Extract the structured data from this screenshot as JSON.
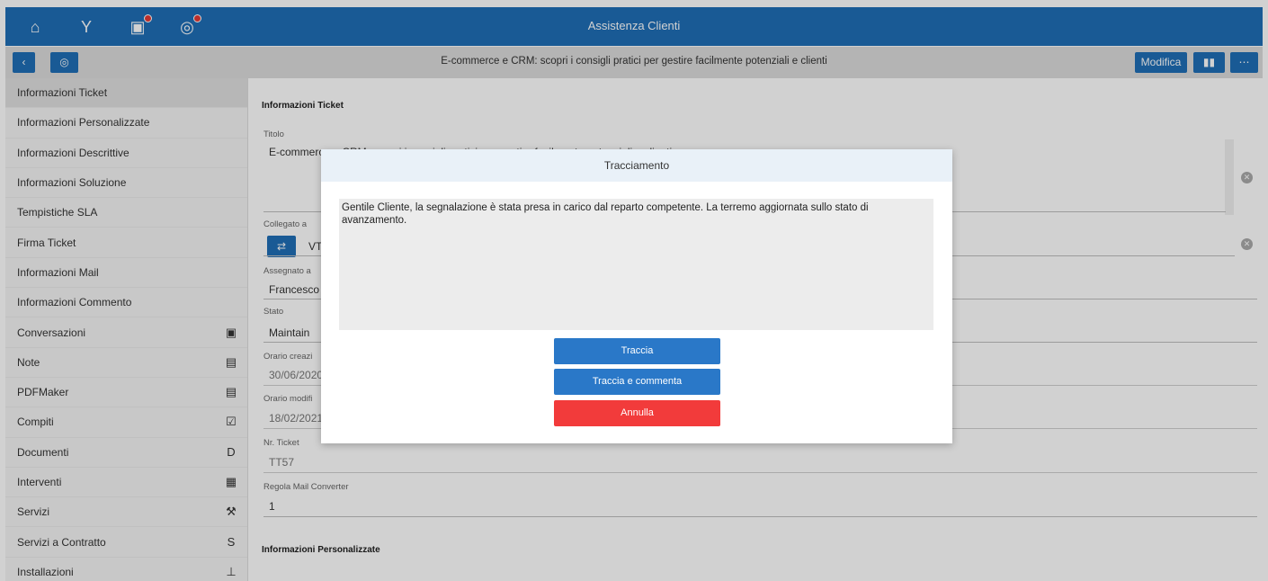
{
  "app": {
    "title": "Assistenza Clienti"
  },
  "topbar": {
    "icons": [
      {
        "name": "home-icon",
        "glyph": "⌂"
      },
      {
        "name": "filter-icon",
        "glyph": "Y"
      },
      {
        "name": "chat-icon",
        "glyph": "▣",
        "badge": true
      },
      {
        "name": "globe-icon",
        "glyph": "◎",
        "badge": true
      }
    ]
  },
  "subbar": {
    "back_glyph": "‹",
    "globe_glyph": "◎",
    "record_title": "E-commerce e CRM: scopri i consigli pratici per gestire facilmente potenziali e clienti",
    "edit_label": "Modifica",
    "stats_glyph": "▮▮",
    "more_glyph": "⋯"
  },
  "sidebar": {
    "items": [
      {
        "label": "Informazioni Ticket",
        "icon": "",
        "active": true
      },
      {
        "label": "Informazioni Personalizzate",
        "icon": ""
      },
      {
        "label": "Informazioni Descrittive",
        "icon": ""
      },
      {
        "label": "Informazioni Soluzione",
        "icon": ""
      },
      {
        "label": "Tempistiche SLA",
        "icon": ""
      },
      {
        "label": "Firma Ticket",
        "icon": ""
      },
      {
        "label": "Informazioni Mail",
        "icon": ""
      },
      {
        "label": "Informazioni Commento",
        "icon": ""
      },
      {
        "label": "Conversazioni",
        "icon": "▣"
      },
      {
        "label": "Note",
        "icon": "▤"
      },
      {
        "label": "PDFMaker",
        "icon": "▤"
      },
      {
        "label": "Compiti",
        "icon": "☑"
      },
      {
        "label": "Documenti",
        "icon": "D"
      },
      {
        "label": "Interventi",
        "icon": "▦"
      },
      {
        "label": "Servizi",
        "icon": "⚒"
      },
      {
        "label": "Servizi a Contratto",
        "icon": "S"
      },
      {
        "label": "Installazioni",
        "icon": "⊥"
      }
    ]
  },
  "form": {
    "section1": "Informazioni Ticket",
    "titolo_label": "Titolo",
    "titolo_value": "E-commerce e CRM: scopri i consigli pratici per gestire facilmente potenziali e clienti",
    "collegato_label": "Collegato a",
    "collegato_value": "VT",
    "assegnato_label": "Assegnato a",
    "assegnato_value": "Francesco",
    "stato_label": "Stato",
    "stato_value": "Maintain",
    "creazione_label": "Orario creazi",
    "creazione_value": "30/06/2020",
    "modifica_label": "Orario modifi",
    "modifica_value": "18/02/2021",
    "nr_label": "Nr. Ticket",
    "nr_value": "TT57",
    "regola_label": "Regola Mail Converter",
    "regola_value": "1",
    "section2": "Informazioni Personalizzate"
  },
  "modal": {
    "title": "Tracciamento",
    "message": "Gentile Cliente, la segnalazione è stata presa in carico dal reparto competente. La terremo aggiornata sullo stato di avanzamento.",
    "btn_track": "Traccia",
    "btn_track_comment": "Traccia e commenta",
    "btn_cancel": "Annulla"
  },
  "colors": {
    "primary": "#1f6eb6",
    "danger": "#f23b3b",
    "modal_header": "#e9f1f8"
  }
}
